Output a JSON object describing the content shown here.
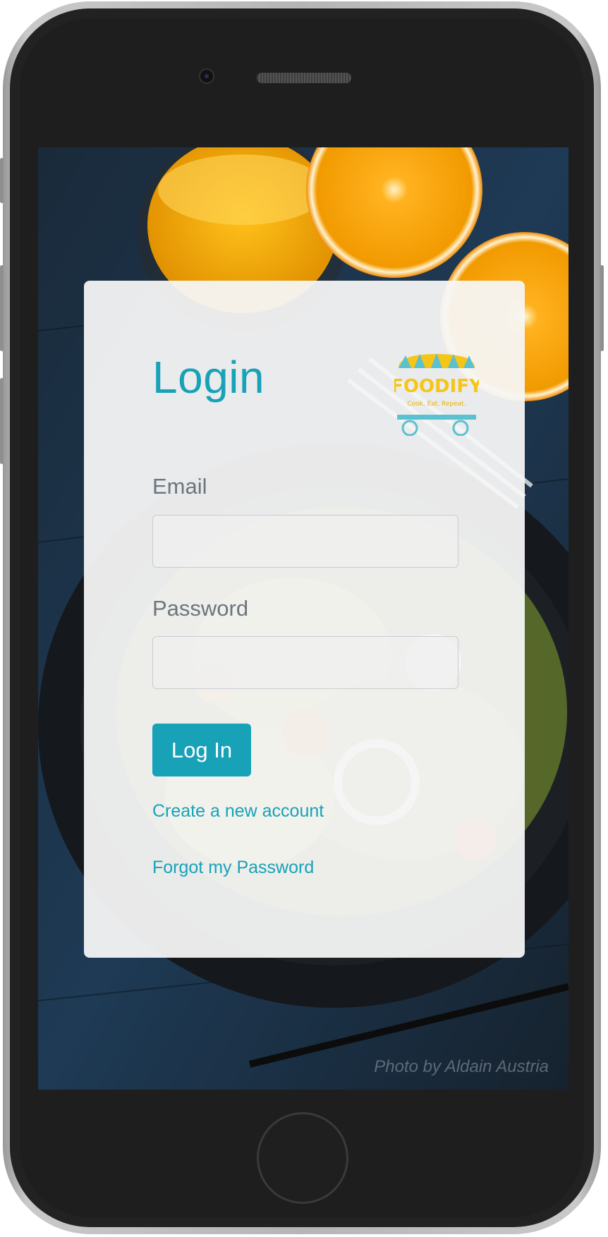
{
  "login": {
    "title": "Login",
    "email_label": "Email",
    "email_value": "",
    "password_label": "Password",
    "password_value": "",
    "submit_label": "Log In",
    "create_account_link": "Create a new account",
    "forgot_password_link": "Forgot my Password"
  },
  "logo": {
    "brand_name": "FOODIFY",
    "tagline": "Cook. Eat. Repeat."
  },
  "background": {
    "photo_credit": "Photo by Aldain Austria"
  },
  "colors": {
    "accent": "#17a2b8",
    "label_gray": "#6c757d",
    "logo_yellow": "#f5c518",
    "logo_teal": "#5bc0d0"
  }
}
